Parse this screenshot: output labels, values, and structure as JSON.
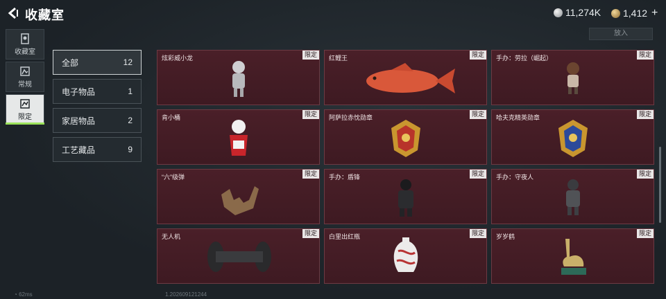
{
  "header": {
    "title": "收藏室",
    "silver_amount": "11,274K",
    "gold_amount": "1,412",
    "plus_label": "+"
  },
  "rail": [
    {
      "label": "收藏室",
      "icon": "collection-icon"
    },
    {
      "label": "常规",
      "icon": "regular-icon"
    },
    {
      "label": "限定",
      "icon": "limited-icon"
    }
  ],
  "put_in_label": "放入",
  "categories": [
    {
      "label": "全部",
      "count": "12"
    },
    {
      "label": "电子物品",
      "count": "1"
    },
    {
      "label": "家居物品",
      "count": "2"
    },
    {
      "label": "工艺藏品",
      "count": "9"
    }
  ],
  "tag_label": "限定",
  "items": [
    {
      "name": "炫彩威小龙",
      "art": "figure-icon"
    },
    {
      "name": "红鲤王",
      "art": "fish-icon"
    },
    {
      "name": "手办：劳拉（崛起）",
      "art": "figure-icon"
    },
    {
      "name": "肯小桶",
      "art": "bucket-figure-icon"
    },
    {
      "name": "阿萨拉赤忱勋章",
      "art": "medal-gold-icon"
    },
    {
      "name": "哈夫克精英勋章",
      "art": "medal-blue-icon"
    },
    {
      "name": "“六”级弹",
      "art": "hand-sign-icon"
    },
    {
      "name": "手办：盾锋",
      "art": "figure-icon"
    },
    {
      "name": "手办：守夜人",
      "art": "figure-icon"
    },
    {
      "name": "无人机",
      "art": "drone-icon"
    },
    {
      "name": "白里出红瓶",
      "art": "vase-icon"
    },
    {
      "name": "岁岁鹤",
      "art": "crane-icon"
    }
  ],
  "footer": {
    "ping": "62ms",
    "build": "1.202609121244"
  },
  "colors": {
    "card_bg": "#4a1f28",
    "accent_green": "#9be25a",
    "tag_bg": "#e9e6e6"
  }
}
